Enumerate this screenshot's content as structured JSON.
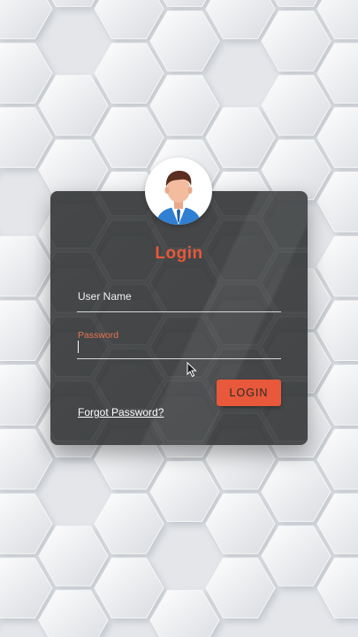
{
  "login": {
    "title": "Login",
    "username_label": "User Name",
    "username_value": "",
    "password_label": "Password",
    "password_value": "",
    "login_button": "LOGIN",
    "forgot_link": "Forgot Password?"
  },
  "colors": {
    "accent": "#e8583a",
    "card": "#3c3e40",
    "background": "#e4e6ea"
  },
  "icons": {
    "avatar": "user-avatar-icon",
    "cursor": "mouse-pointer-icon"
  }
}
